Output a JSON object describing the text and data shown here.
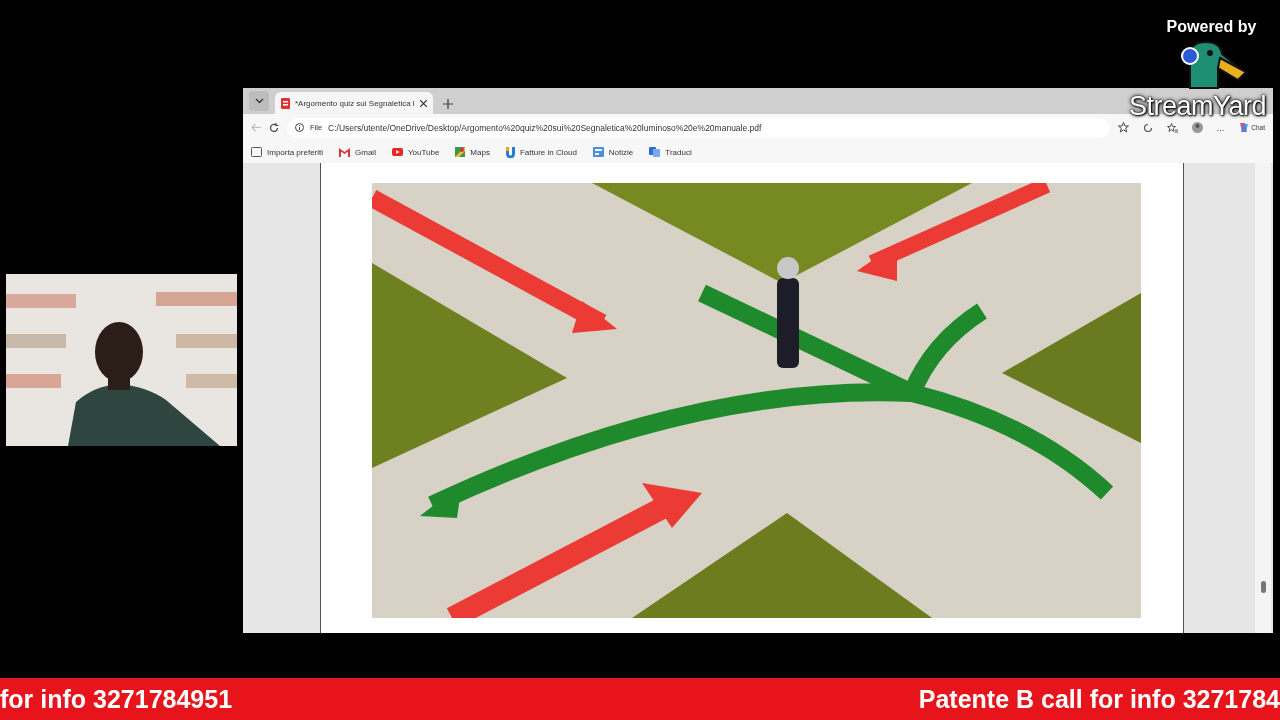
{
  "overlay": {
    "powered_by": "Powered by",
    "brand": "StreamYard"
  },
  "browser": {
    "tabs": [
      {
        "title": "*Argomento quiz sui Segnaletica l",
        "selected": true
      }
    ],
    "address": {
      "scheme": "File",
      "url": "C:/Users/utente/OneDrive/Desktop/Argomento%20quiz%20sui%20Segnaletica%20luminoso%20e%20manuale.pdf"
    },
    "bookmarks": [
      {
        "label": "Importa preferiti"
      },
      {
        "label": "Gmail"
      },
      {
        "label": "YouTube"
      },
      {
        "label": "Maps"
      },
      {
        "label": "Fatture in Cloud"
      },
      {
        "label": "Notizie"
      },
      {
        "label": "Traduci"
      }
    ],
    "more": "...",
    "chat": "Chat"
  },
  "ticker": [
    "for info 3271784951",
    "Patente B call for info 3271784"
  ]
}
